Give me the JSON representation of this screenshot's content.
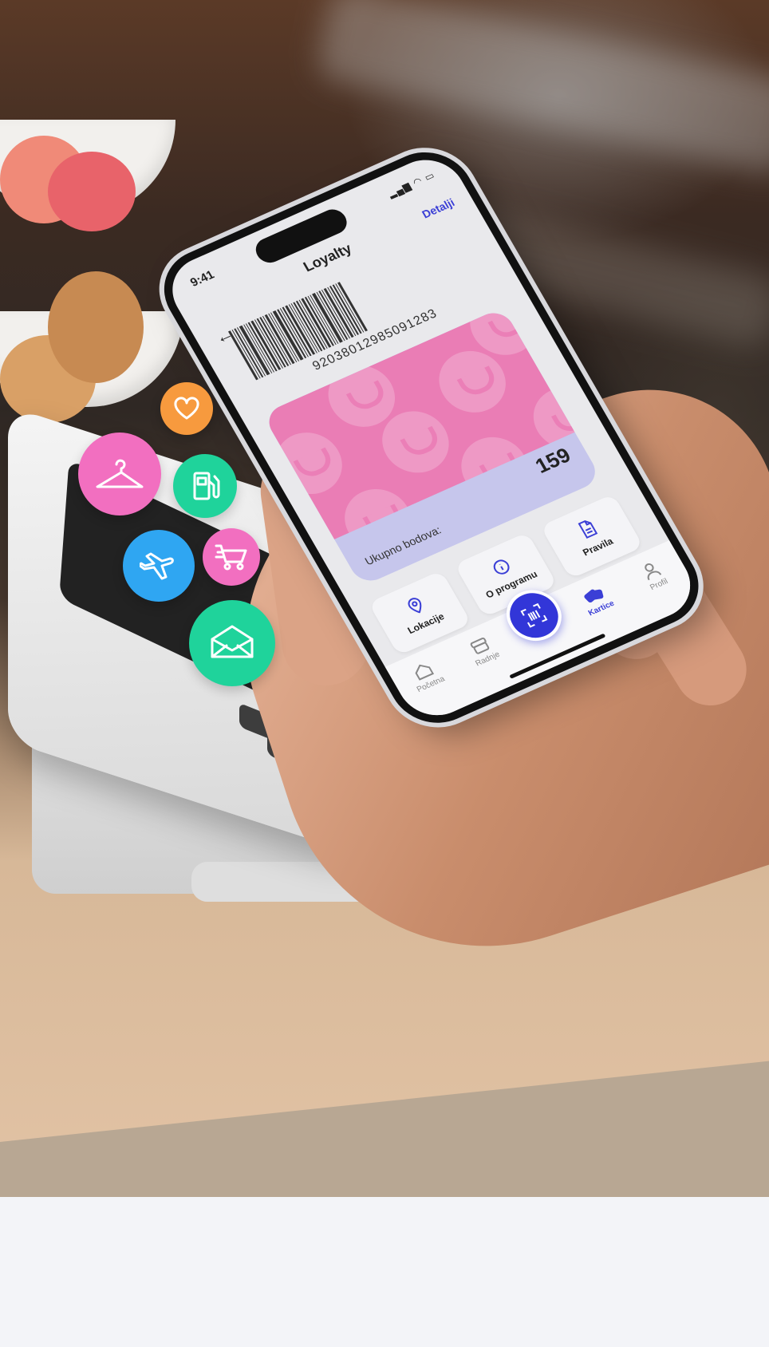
{
  "status_bar": {
    "time": "9:41"
  },
  "nav": {
    "title": "Loyalty",
    "details_link": "Detalji"
  },
  "card": {
    "barcode_number": "92038012985091283",
    "points_label": "Ukupno bodova:",
    "points_value": "159"
  },
  "actions": [
    {
      "label": "Lokacije",
      "icon": "location-pin-icon"
    },
    {
      "label": "O programu",
      "icon": "info-icon"
    },
    {
      "label": "Pravila",
      "icon": "document-icon"
    }
  ],
  "tabbar": [
    {
      "label": "Početna",
      "icon": "home-icon"
    },
    {
      "label": "Radnje",
      "icon": "store-icon"
    },
    {
      "label": "",
      "icon": "barcode-scan-icon"
    },
    {
      "label": "Kartice",
      "icon": "cards-icon"
    },
    {
      "label": "Profil",
      "icon": "profile-icon"
    }
  ],
  "bubbles": [
    {
      "icon": "heart-icon",
      "color": "#f79a3e"
    },
    {
      "icon": "hanger-icon",
      "color": "#f26fc0"
    },
    {
      "icon": "fuel-pump-icon",
      "color": "#1fd39b"
    },
    {
      "icon": "airplane-icon",
      "color": "#2fa6f2"
    },
    {
      "icon": "shopping-cart-icon",
      "color": "#f26fc0"
    },
    {
      "icon": "envelope-icon",
      "color": "#1fd39b"
    }
  ],
  "colors": {
    "accent": "#3b3fd6",
    "card_pink": "#ea7db5",
    "card_lavender": "#c6c6ec"
  }
}
